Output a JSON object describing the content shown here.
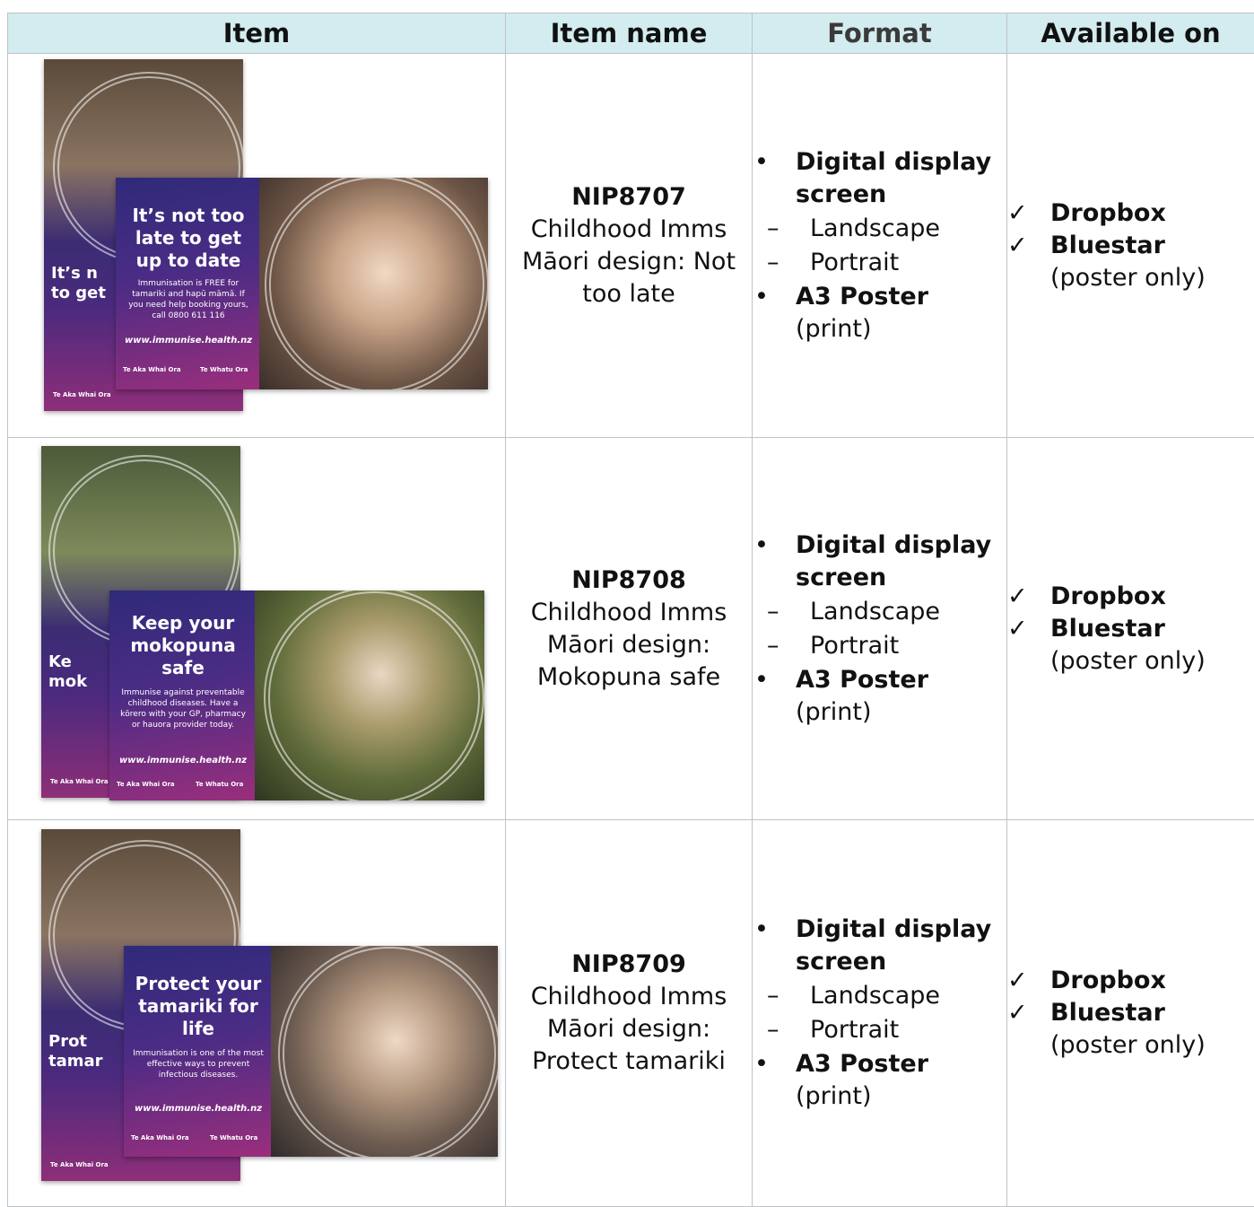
{
  "table": {
    "headers": [
      "Item",
      "Item name",
      "Format",
      "Available on"
    ],
    "rows": [
      {
        "code": "NIP8707",
        "description": "Childhood Imms Māori design: Not too late",
        "poster": {
          "headline": "It’s not too late to get up to date",
          "body": "Immunisation is FREE for tamariki and hapū māmā. If you need help booking yours, call 0800 611 116",
          "url": "www.immunise.health.nz",
          "logo_left": "Te Aka Whai Ora",
          "logo_right": "Te Whatu Ora",
          "portrait_headline_partial": "It’s n to get"
        },
        "format": {
          "item1": "Digital display screen",
          "sub1": "Landscape",
          "sub2": "Portrait",
          "item2": "A3 Poster",
          "item2_note": "(print)"
        },
        "available": {
          "opt1": "Dropbox",
          "opt2": "Bluestar",
          "note": "(poster only)"
        }
      },
      {
        "code": "NIP8708",
        "description": "Childhood Imms Māori design: Mokopuna safe",
        "poster": {
          "headline": "Keep your mokopuna safe",
          "body": "Immunise against preventable childhood diseases. Have a kōrero with your GP, pharmacy or hauora provider today.",
          "url": "www.immunise.health.nz",
          "logo_left": "Te Aka Whai Ora",
          "logo_right": "Te Whatu Ora",
          "portrait_headline_partial": "Ke mok"
        },
        "format": {
          "item1": "Digital display screen",
          "sub1": "Landscape",
          "sub2": "Portrait",
          "item2": "A3 Poster",
          "item2_note": "(print)"
        },
        "available": {
          "opt1": "Dropbox",
          "opt2": "Bluestar",
          "note": "(poster only)"
        }
      },
      {
        "code": "NIP8709",
        "description": "Childhood Imms Māori design: Protect tamariki",
        "poster": {
          "headline": "Protect your tamariki for life",
          "body": "Immunisation is one of the most effective ways to prevent infectious diseases.",
          "url": "www.immunise.health.nz",
          "logo_left": "Te Aka Whai Ora",
          "logo_right": "Te Whatu Ora",
          "portrait_headline_partial": "Prot tamar"
        },
        "format": {
          "item1": "Digital display screen",
          "sub1": "Landscape",
          "sub2": "Portrait",
          "item2": "A3 Poster",
          "item2_note": "(print)"
        },
        "available": {
          "opt1": "Dropbox",
          "opt2": "Bluestar",
          "note": "(poster only)"
        }
      }
    ]
  }
}
